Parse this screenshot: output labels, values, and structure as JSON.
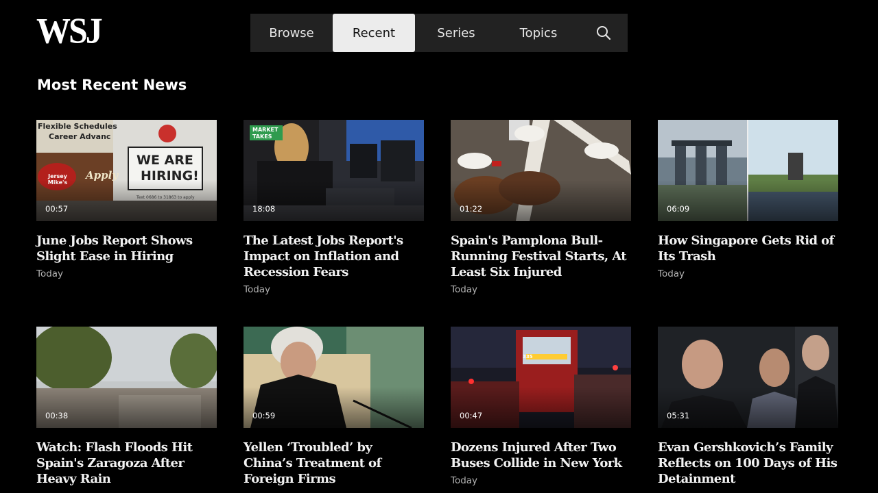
{
  "header": {
    "logo": "WSJ",
    "tabs": [
      {
        "label": "Browse"
      },
      {
        "label": "Recent"
      },
      {
        "label": "Series"
      },
      {
        "label": "Topics"
      }
    ]
  },
  "section": {
    "title": "Most Recent News"
  },
  "videos": [
    {
      "title": "June Jobs Report Shows Slight Ease in Hiring",
      "date": "Today",
      "duration": "00:57",
      "thumb_text": [
        "Flexible Schedules",
        "Career Advanc",
        "WE ARE",
        "HIRING!",
        "Jersey Mike's",
        "Apply",
        "Text 0686 to 31863 to apply"
      ]
    },
    {
      "title": "The Latest Jobs Report's Impact on Inflation and Recession Fears",
      "date": "Today",
      "duration": "18:08",
      "badge": [
        "MARKET",
        "TAKES"
      ]
    },
    {
      "title": "Spain's Pamplona Bull-Running Festival Starts, At Least Six Injured",
      "date": "Today",
      "duration": "01:22"
    },
    {
      "title": "How Singapore Gets Rid of Its Trash",
      "date": "Today",
      "duration": "06:09"
    },
    {
      "title": "Watch: Flash Floods Hit Spain's Zaragoza After Heavy Rain",
      "date": "",
      "duration": "00:38"
    },
    {
      "title": "Yellen ‘Troubled’ by China’s Treatment of Foreign Firms",
      "date": "",
      "duration": "00:59"
    },
    {
      "title": "Dozens Injured After Two Buses Collide in New York",
      "date": "Today",
      "duration": "00:47",
      "thumb_text": [
        "335"
      ]
    },
    {
      "title": "Evan Gershkovich’s Family Reflects on 100 Days of His Detainment",
      "date": "",
      "duration": "05:31"
    }
  ],
  "colors": {
    "background": "#000000",
    "nav_background": "#222222",
    "nav_active": "#ececec",
    "badge_green": "#2f9b4e",
    "date_text": "#b3b3b3"
  },
  "icons": {
    "search": "search-icon"
  }
}
